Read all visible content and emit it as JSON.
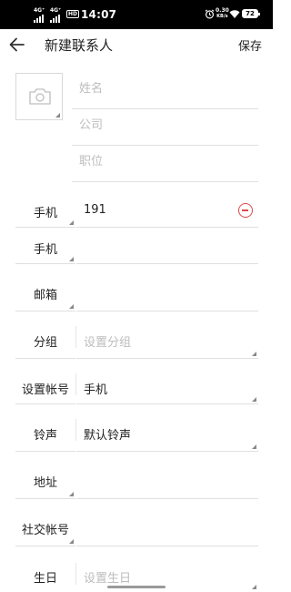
{
  "status_bar": {
    "signal1": "4G⁺",
    "signal2": "4G⁺",
    "hd": "HD",
    "time": "14:07",
    "speed_value": "0.30",
    "speed_unit": "KB/s",
    "battery": "72"
  },
  "header": {
    "title": "新建联系人",
    "save_label": "保存"
  },
  "name_fields": {
    "name_placeholder": "姓名",
    "company_placeholder": "公司",
    "position_placeholder": "职位"
  },
  "rows": {
    "phone1": {
      "label": "手机",
      "value": "191"
    },
    "phone2": {
      "label": "手机",
      "value": ""
    },
    "email": {
      "label": "邮箱",
      "value": ""
    },
    "group": {
      "label": "分组",
      "placeholder": "设置分组"
    },
    "account": {
      "label": "设置帐号",
      "value": "手机"
    },
    "ringtone": {
      "label": "铃声",
      "value": "默认铃声"
    },
    "address": {
      "label": "地址",
      "value": ""
    },
    "social": {
      "label": "社交帐号",
      "value": ""
    },
    "birthday": {
      "label": "生日",
      "placeholder": "设置生日"
    }
  },
  "icons": {
    "back": "back-arrow-icon",
    "photo": "camera-icon",
    "remove": "remove-circle-icon"
  },
  "colors": {
    "remove_red": "#e04848",
    "placeholder_gray": "#bdbdbd"
  }
}
